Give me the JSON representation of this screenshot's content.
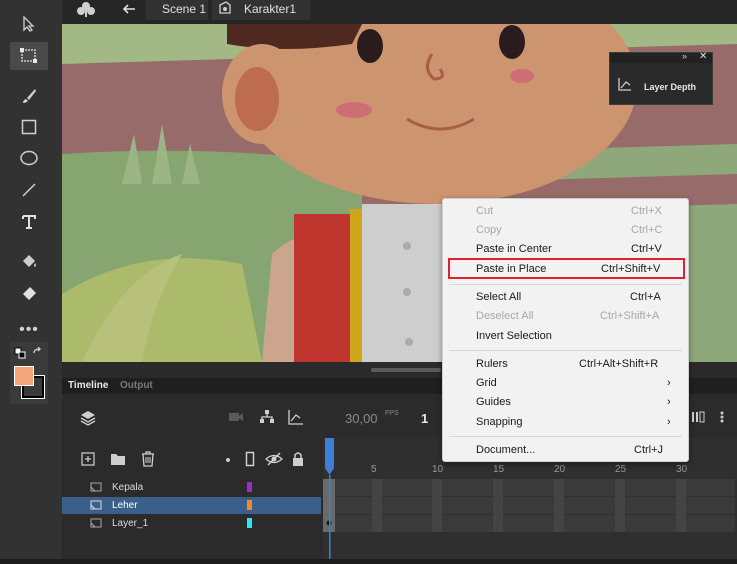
{
  "breadcrumb": {
    "scene_label": "Scene 1",
    "symbol_label": "Karakter1"
  },
  "floating_panel": {
    "title": "Layer Depth"
  },
  "timeline": {
    "tabs": [
      "Timeline",
      "Output"
    ],
    "fps_value": "30,00",
    "fps_unit": "FPS",
    "current_frame": "1",
    "ruler_ticks": [
      "5",
      "10",
      "15",
      "20",
      "25",
      "30"
    ],
    "layers": [
      {
        "name": "Kepala",
        "color": "#9b30c8",
        "selected": false
      },
      {
        "name": "Leher",
        "color": "#f08a24",
        "selected": true
      },
      {
        "name": "Layer_1",
        "color": "#2ee8f0",
        "selected": false
      }
    ]
  },
  "colors": {
    "fill_swatch": "#f4a57a",
    "stroke_swatch": "#000000",
    "menu_highlight": "#e02030",
    "selected_layer": "#3a5f8a",
    "playhead": "#3d7fd6"
  },
  "context_menu": {
    "items": [
      {
        "label": "Cut",
        "shortcut": "Ctrl+X",
        "disabled": true
      },
      {
        "label": "Copy",
        "shortcut": "Ctrl+C",
        "disabled": true
      },
      {
        "label": "Paste in Center",
        "shortcut": "Ctrl+V",
        "disabled": false
      },
      {
        "label": "Paste in Place",
        "shortcut": "Ctrl+Shift+V",
        "disabled": false,
        "highlighted": true
      },
      {
        "label": "Select All",
        "shortcut": "Ctrl+A",
        "disabled": false
      },
      {
        "label": "Deselect All",
        "shortcut": "Ctrl+Shift+A",
        "disabled": true
      },
      {
        "label": "Invert Selection",
        "shortcut": "",
        "disabled": false
      },
      {
        "label": "Rulers",
        "shortcut": "Ctrl+Alt+Shift+R",
        "disabled": false
      },
      {
        "label": "Grid",
        "shortcut": "",
        "submenu": true,
        "disabled": false
      },
      {
        "label": "Guides",
        "shortcut": "",
        "submenu": true,
        "disabled": false
      },
      {
        "label": "Snapping",
        "shortcut": "",
        "submenu": true,
        "disabled": false
      },
      {
        "label": "Document...",
        "shortcut": "Ctrl+J",
        "disabled": false
      }
    ]
  }
}
